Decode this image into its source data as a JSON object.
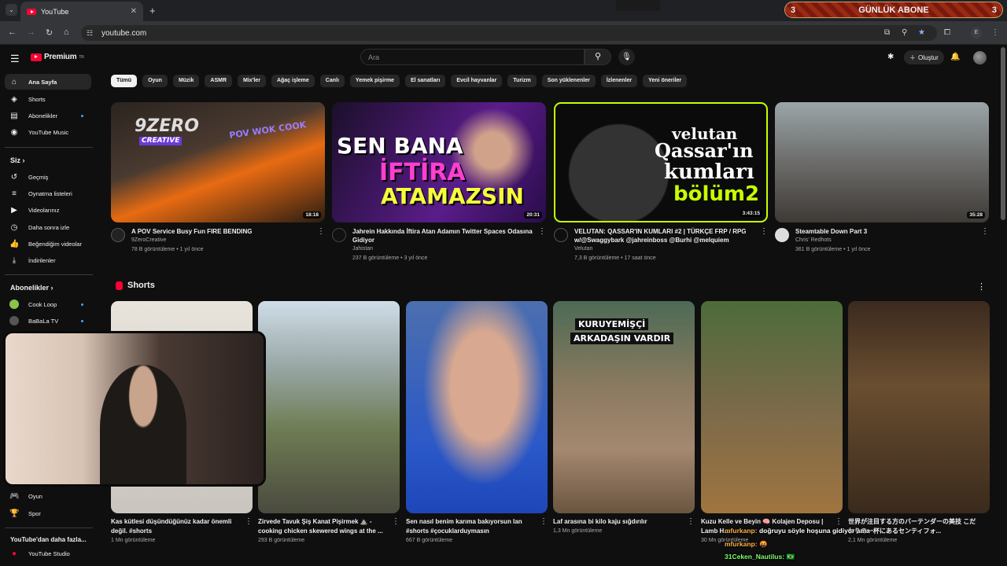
{
  "browser": {
    "tab_title": "YouTube",
    "url": "youtube.com",
    "profile_letter": "E",
    "banner": {
      "left": "3",
      "text": "GÜNLÜK ABONE",
      "right": "3"
    }
  },
  "header": {
    "logo": "Premium",
    "logo_region": "TR",
    "search_placeholder": "Ara",
    "create_label": "Oluştur"
  },
  "sidebar": {
    "main": [
      {
        "label": "Ana Sayfa",
        "icon": "home-icon"
      },
      {
        "label": "Shorts",
        "icon": "shorts-icon"
      },
      {
        "label": "Abonelikler",
        "icon": "subscriptions-icon"
      },
      {
        "label": "YouTube Music",
        "icon": "youtube-music-icon"
      }
    ],
    "you_header": "Siz",
    "you": [
      {
        "label": "Geçmiş"
      },
      {
        "label": "Oynatma listeleri"
      },
      {
        "label": "Videolarınız"
      },
      {
        "label": "Daha sonra izle"
      },
      {
        "label": "Beğendiğim videolar"
      },
      {
        "label": "İndirilenler"
      }
    ],
    "subs_header": "Abonelikler",
    "subs": [
      {
        "label": "Cook Loop"
      },
      {
        "label": "BaBaLa TV"
      }
    ],
    "explore": [
      {
        "label": "Oyun"
      },
      {
        "label": "Spor"
      }
    ],
    "more_header": "YouTube'dan daha fazla...",
    "more": [
      {
        "label": "YouTube Studio"
      }
    ]
  },
  "chips": [
    "Tümü",
    "Oyun",
    "Müzik",
    "ASMR",
    "Mix'ler",
    "Ağaç işleme",
    "Canlı",
    "Yemek pişirme",
    "El sanatları",
    "Evcil hayvanlar",
    "Turizm",
    "Son yüklenenler",
    "İzlenenler",
    "Yeni öneriler"
  ],
  "videos": [
    {
      "title": "A POV Service  Busy  Fun  FIRE BENDING",
      "channel": "9ZeroCreative",
      "meta": "78 B görüntüleme • 1 yıl önce",
      "duration": "18:18",
      "overlay1": "9ZERO",
      "overlay2": "CREATIVE",
      "overlay3": "POV WOK COOK"
    },
    {
      "title": "Jahrein Hakkında İftira Atan Adamın Twitter Spaces Odasına Gidiyor",
      "channel": "Jahistan",
      "meta": "237 B görüntüleme • 3 yıl önce",
      "duration": "20:31",
      "overlay1": "SEN BANA",
      "overlay2": "İFTİRA",
      "overlay3": "ATAMAZSIN"
    },
    {
      "title": "VELUTAN: QASSAR'IN KUMLARI #2 | TÜRKÇE FRP / RPG w/@Swaggybark @jahreinboss @Burhi @melquiem",
      "channel": "Velutan",
      "meta": "7,3 B görüntüleme • 17 saat önce",
      "duration": "3:43:15",
      "overlay1": "velutan",
      "overlay2": "Qassar'ın",
      "overlay3": "kumları",
      "overlay4": "bölüm2"
    },
    {
      "title": "Steamtable Down Part 3",
      "channel": "Chris' Redhots",
      "meta": "361 B görüntüleme • 1 yıl önce",
      "duration": "35:28"
    }
  ],
  "shorts_header": "Shorts",
  "shorts": [
    {
      "title": "Kas kütlesi düşündüğünüz kadar önemli değil. #shorts",
      "views": "1 Mn görüntüleme"
    },
    {
      "title": "Zirvede Tavuk Şiş Kanat Pişirmek ⛰️ - cooking chicken skewered wings at the ...",
      "views": "293 B görüntüleme"
    },
    {
      "title": "Sen nasıl benim karıma bakıyorsun lan #shorts #çocuklarduymasın",
      "views": "667 B görüntüleme"
    },
    {
      "title": "Laf arasına bi kilo kaju sığdırılır",
      "views": "1,3 Mn görüntüleme",
      "overlay1": "KURUYEMİŞÇİ",
      "overlay2": "ARKADAŞIN VARDIR"
    },
    {
      "title": "Kuzu Kelle ve Beyin 🧠 Kolajen Deposu | Lamb H...",
      "views": "30 Mn görüntüleme"
    },
    {
      "title": "世界が注目する方のバーテンダーの美技 こだわりの一杯にあるセンティフォ...",
      "views": "2,1 Mn görüntüleme"
    }
  ],
  "chat": [
    {
      "user": "mfurkanp:",
      "msg": "doğruyu söyle hoşuna gidiyor ama"
    },
    {
      "user": "mfurkanp:",
      "msg": "🤬"
    },
    {
      "user": "31Ceken_Nautilus:",
      "msg": "🇧🇷"
    }
  ]
}
